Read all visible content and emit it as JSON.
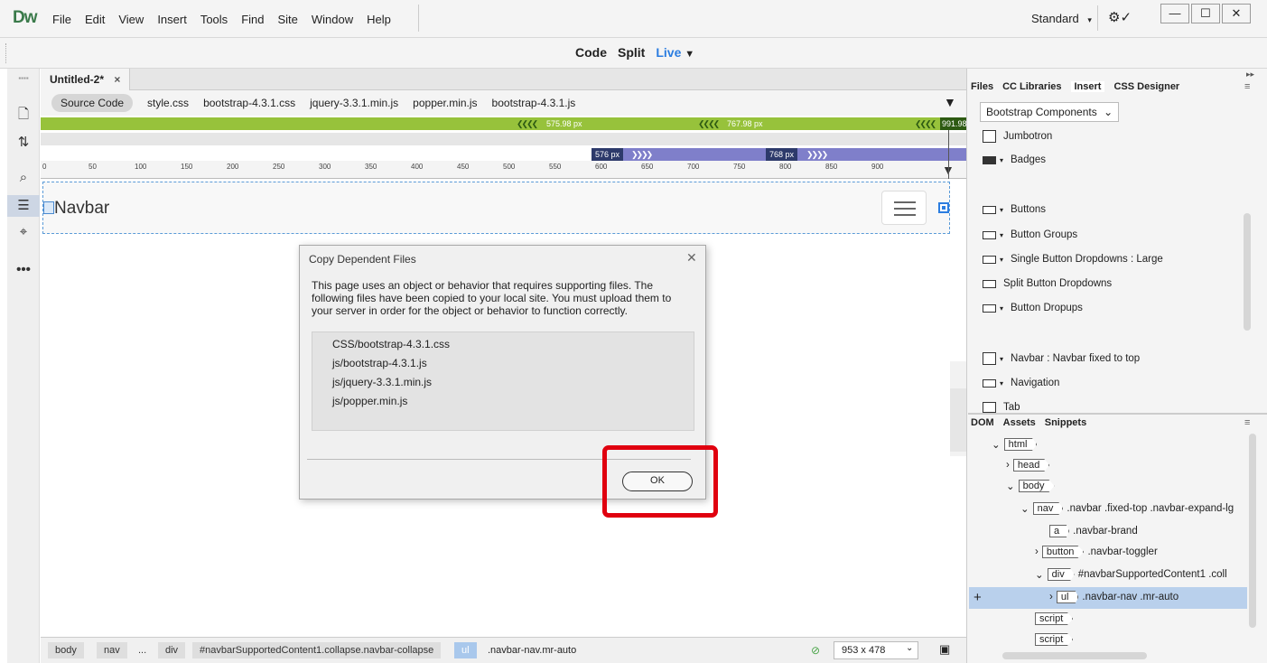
{
  "app": {
    "logo": "Dw",
    "menus": [
      "File",
      "Edit",
      "View",
      "Insert",
      "Tools",
      "Find",
      "Site",
      "Window",
      "Help"
    ],
    "workspace": "Standard",
    "window_controls": {
      "minimize": "—",
      "maximize": "☐",
      "close": "✕"
    }
  },
  "viewbar": {
    "code": "Code",
    "split": "Split",
    "live": "Live"
  },
  "document": {
    "tab": "Untitled-2*",
    "tab_close": "×",
    "related_files": [
      "Source Code",
      "style.css",
      "bootstrap-4.3.1.css",
      "jquery-3.3.1.min.js",
      "popper.min.js",
      "bootstrap-4.3.1.js"
    ]
  },
  "media_queries": {
    "green": [
      "575.98 px",
      "767.98 px",
      "991.98"
    ],
    "purple": [
      "576 px",
      "768 px"
    ]
  },
  "ruler": {
    "ticks": [
      "0",
      "50",
      "100",
      "150",
      "200",
      "250",
      "300",
      "350",
      "400",
      "450",
      "500",
      "550",
      "600",
      "650",
      "700",
      "750",
      "800",
      "850",
      "900"
    ]
  },
  "live_view": {
    "navbar_brand": "Navbar"
  },
  "dialog": {
    "title": "Copy Dependent Files",
    "close": "✕",
    "message": "This page uses an object or behavior that requires supporting files. The following files have been copied to your local site. You must upload them to your server in order for the object or behavior to function correctly.",
    "files": [
      "CSS/bootstrap-4.3.1.css",
      "js/bootstrap-4.3.1.js",
      "js/jquery-3.3.1.min.js",
      "js/popper.min.js"
    ],
    "ok_label": "OK",
    "highlight_color": "#e0000f"
  },
  "statusbar": {
    "crumbs": [
      "body",
      "nav",
      "...",
      "div",
      "#navbarSupportedContent1.collapse.navbar-collapse",
      "ul"
    ],
    "final": ".navbar-nav.mr-auto",
    "viewport": "953 x 478"
  },
  "right_panel": {
    "tabs": [
      "Files",
      "CC Libraries",
      "Insert",
      "CSS Designer"
    ],
    "active_tab": "Insert",
    "component_select": "Bootstrap Components",
    "insert_items": [
      "Jumbotron",
      "Badges",
      "Buttons",
      "Button Groups",
      "Single Button Dropdowns : Large",
      "Split Button Dropdowns",
      "Button Dropups",
      "Navbar : Navbar fixed to top",
      "Navigation",
      "Tab"
    ],
    "dom_tabs": [
      "DOM",
      "Assets",
      "Snippets"
    ],
    "dom_tree": [
      {
        "tag": "html",
        "desc": ""
      },
      {
        "tag": "head",
        "desc": ""
      },
      {
        "tag": "body",
        "desc": ""
      },
      {
        "tag": "nav",
        "desc": ".navbar .fixed-top .navbar-expand-lg"
      },
      {
        "tag": "a",
        "desc": ".navbar-brand"
      },
      {
        "tag": "button",
        "desc": ".navbar-toggler"
      },
      {
        "tag": "div",
        "desc": "#navbarSupportedContent1 .coll"
      },
      {
        "tag": "ul",
        "desc": ".navbar-nav .mr-auto"
      },
      {
        "tag": "script",
        "desc": ""
      },
      {
        "tag": "script",
        "desc": ""
      }
    ]
  }
}
